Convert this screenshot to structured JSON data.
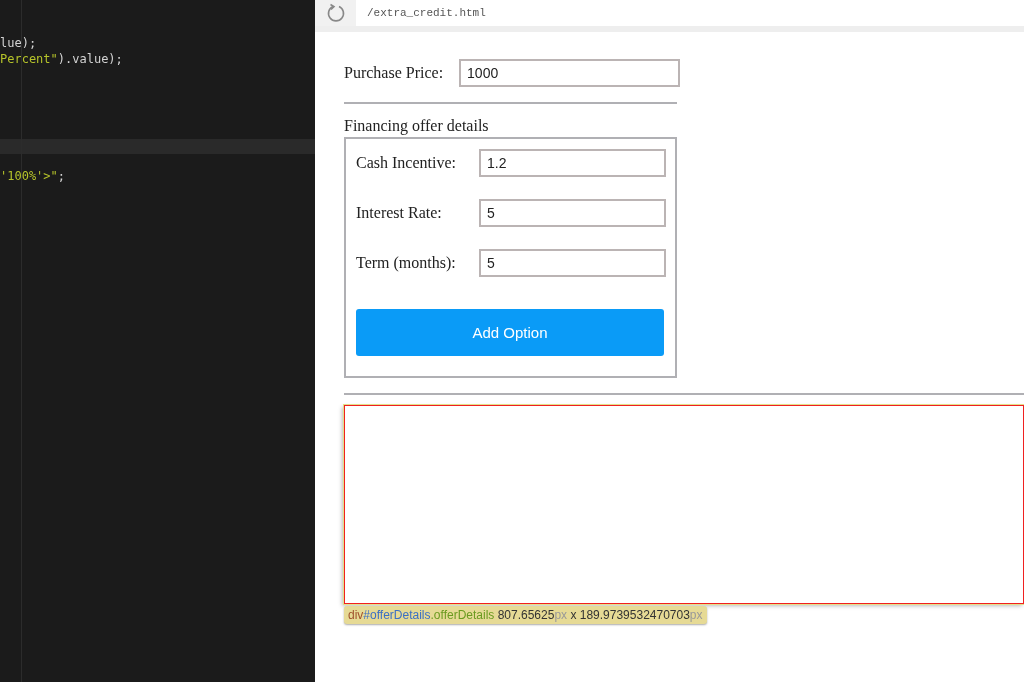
{
  "editor": {
    "lines": [
      {
        "current": false,
        "segments": [
          {
            "text": "lue);",
            "kind": "plain"
          }
        ]
      },
      {
        "current": false,
        "segments": [
          {
            "text": "Percent\"",
            "kind": "string"
          },
          {
            "text": ").value);",
            "kind": "plain"
          }
        ]
      },
      {
        "current": true
      },
      {
        "current": false,
        "segments": [
          {
            "text": "'100%'>\"",
            "kind": "string"
          },
          {
            "text": ";",
            "kind": "plain"
          }
        ]
      }
    ]
  },
  "browser": {
    "address": "/extra_credit.html"
  },
  "form": {
    "purchase": {
      "label": "Purchase Price:",
      "value": "1000"
    },
    "section_title": "Financing offer details",
    "fields": [
      {
        "label": "Cash Incentive:",
        "value": "1.2"
      },
      {
        "label": "Interest Rate:",
        "value": "5"
      },
      {
        "label": "Term (months):",
        "value": "5"
      }
    ],
    "button": "Add Option"
  },
  "inspector_tooltip": {
    "parts": [
      {
        "text": "div",
        "kind": "tag"
      },
      {
        "text": "#offerDetails",
        "kind": "id"
      },
      {
        "text": ".offerDetails",
        "kind": "class"
      },
      {
        "text": " 807.65625",
        "kind": "num"
      },
      {
        "text": "px",
        "kind": "unit"
      },
      {
        "text": " x 189.9739532470703",
        "kind": "num"
      },
      {
        "text": "px",
        "kind": "unit"
      }
    ]
  }
}
